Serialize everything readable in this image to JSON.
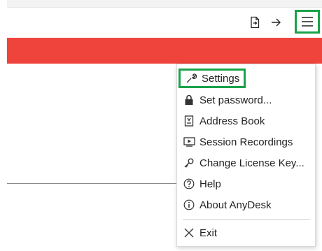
{
  "toolbar": {
    "icons": [
      "file-export-icon",
      "arrow-right-icon",
      "hamburger-menu-icon"
    ]
  },
  "menu": {
    "items": [
      {
        "label": "Settings",
        "icon": "wrench-icon"
      },
      {
        "label": "Set password...",
        "icon": "lock-icon"
      },
      {
        "label": "Address Book",
        "icon": "address-book-icon"
      },
      {
        "label": "Session Recordings",
        "icon": "play-screen-icon"
      },
      {
        "label": "Change License Key...",
        "icon": "key-icon"
      },
      {
        "label": "Help",
        "icon": "help-circle-icon"
      },
      {
        "label": "About AnyDesk",
        "icon": "info-circle-icon"
      },
      {
        "label": "Exit",
        "icon": "close-icon"
      }
    ]
  },
  "colors": {
    "brand_red": "#ef443b",
    "highlight_green": "#1aa34a"
  }
}
